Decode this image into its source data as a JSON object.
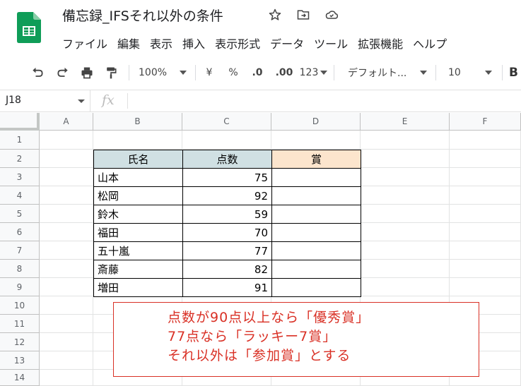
{
  "app": {
    "doc_title": "備忘録_IFSそれ以外の条件",
    "menu": [
      "ファイル",
      "編集",
      "表示",
      "挿入",
      "表示形式",
      "データ",
      "ツール",
      "拡張機能",
      "ヘルプ"
    ],
    "icons": {
      "logo": "google-sheets-logo",
      "star": "star-icon",
      "move": "move-to-folder-icon",
      "cloud": "cloud-saved-icon"
    }
  },
  "toolbar": {
    "zoom": "100%",
    "currency": "¥",
    "percent": "%",
    "decrease_decimal": ".0",
    "increase_decimal": ".00",
    "more_formats": "123",
    "font": "デフォルト...",
    "font_size": "10",
    "bold": "B"
  },
  "formula_bar": {
    "name_box": "J18",
    "fx": "fx",
    "value": ""
  },
  "sheet": {
    "columns": [
      "A",
      "B",
      "C",
      "D",
      "E",
      "F"
    ],
    "rows": [
      "1",
      "2",
      "3",
      "4",
      "5",
      "6",
      "7",
      "8",
      "9",
      "10",
      "11",
      "12",
      "13",
      "14"
    ],
    "table": {
      "headers": [
        "氏名",
        "点数",
        "賞"
      ],
      "header_colors": [
        "#d0e0e3",
        "#d0e0e3",
        "#fce5cd"
      ],
      "records": [
        {
          "name": "山本",
          "score": "75",
          "award": ""
        },
        {
          "name": "松岡",
          "score": "92",
          "award": ""
        },
        {
          "name": "鈴木",
          "score": "59",
          "award": ""
        },
        {
          "name": "福田",
          "score": "70",
          "award": ""
        },
        {
          "name": "五十嵐",
          "score": "77",
          "award": ""
        },
        {
          "name": "斎藤",
          "score": "82",
          "award": ""
        },
        {
          "name": "増田",
          "score": "91",
          "award": ""
        }
      ]
    },
    "note": {
      "lines": [
        "点数が90点以上なら「優秀賞」",
        "77点なら「ラッキー7賞」",
        "それ以外は「参加賞」とする"
      ],
      "color": "#d93025"
    }
  }
}
